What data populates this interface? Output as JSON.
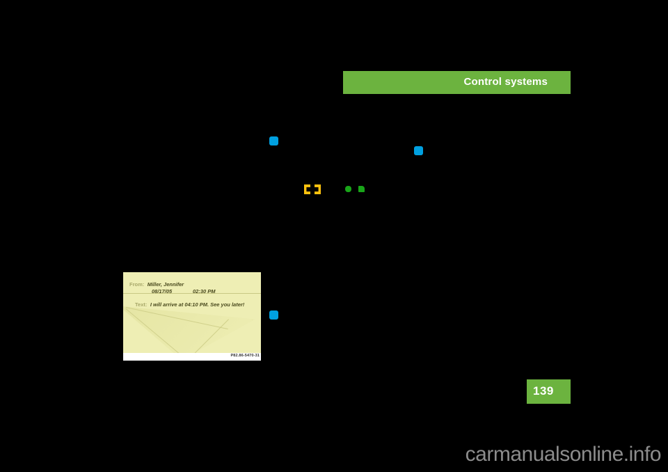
{
  "page": {
    "background_color": "#000000",
    "accent_green": "#6cb33f",
    "page_number": "139",
    "watermark": "carmanualsonline.info"
  },
  "header": {
    "title": "Control systems"
  },
  "markers": {
    "blue_bullets": [
      {
        "name": "bullet-blue-1",
        "color": "#00a0e0"
      },
      {
        "name": "bullet-blue-2",
        "color": "#00a0e0"
      },
      {
        "name": "bullet-blue-3",
        "color": "#00a0e0"
      }
    ],
    "yellow_chevrons": [
      {
        "name": "chevron-left",
        "color": "#ffc20e"
      },
      {
        "name": "chevron-right",
        "color": "#ffc20e"
      }
    ],
    "green_markers": [
      {
        "name": "marker-green-1",
        "color": "#19a519"
      },
      {
        "name": "marker-green-2",
        "color": "#19a519"
      }
    ]
  },
  "figure": {
    "name": "message-display",
    "caption_code": "P82.86-5470-31",
    "screen_background": "#eeeeb4",
    "from_label": "From:",
    "from_value": "Miller, Jennifer",
    "date_value": "08/17/05",
    "time_value": "02:30 PM",
    "text_label": "Text:",
    "text_value": "I will arrive at 04:10 PM. See you later!"
  }
}
